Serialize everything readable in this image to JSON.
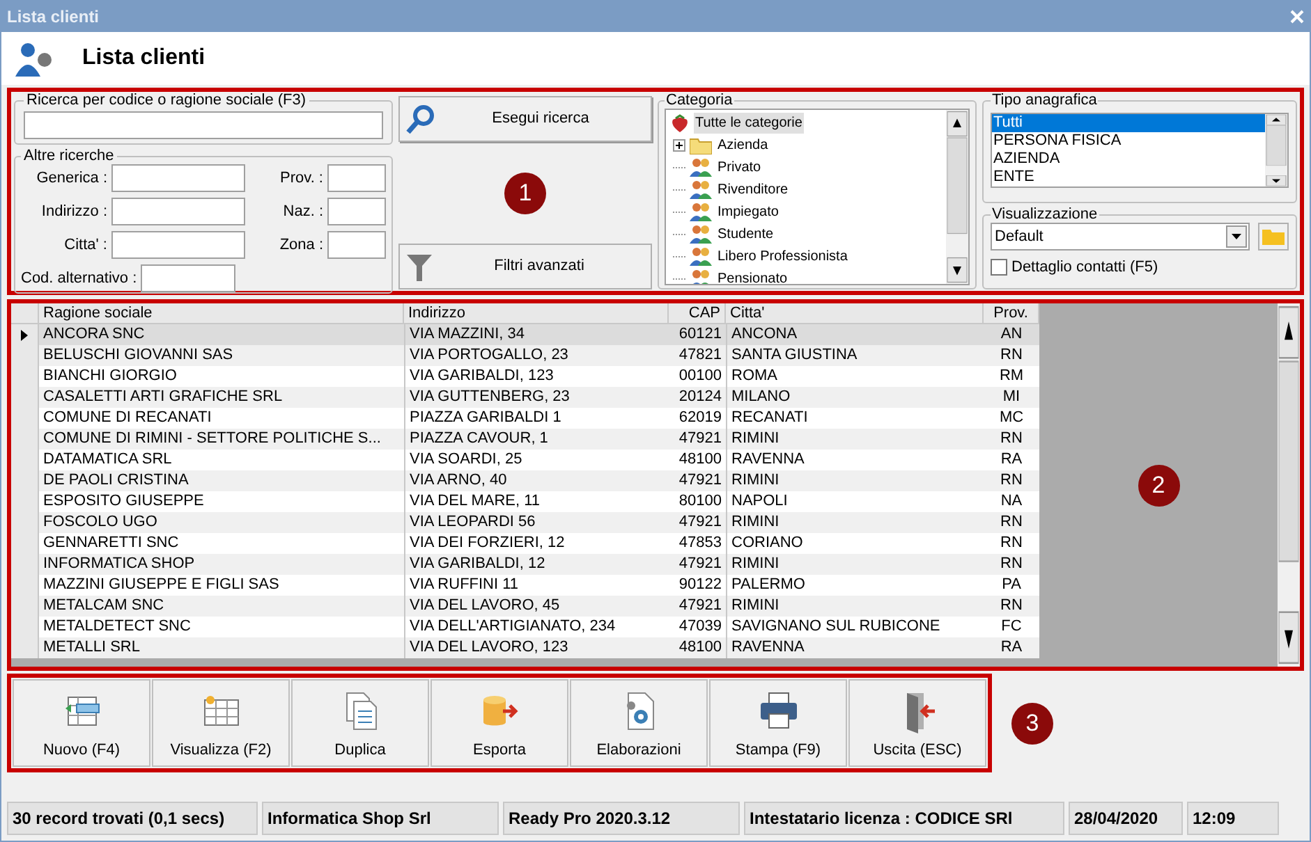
{
  "window": {
    "title": "Lista clienti"
  },
  "header": {
    "title": "Lista clienti"
  },
  "search": {
    "legend": "Ricerca per codice o ragione sociale (F3)",
    "button": "Esegui ricerca"
  },
  "other_search": {
    "legend": "Altre ricerche",
    "fields": [
      {
        "label": "Generica :"
      },
      {
        "label": "Prov. :"
      },
      {
        "label": "Indirizzo :"
      },
      {
        "label": "Naz. :"
      },
      {
        "label": "Citta' :"
      },
      {
        "label": "Zona :"
      },
      {
        "label": "Cod. alternativo :"
      }
    ]
  },
  "filter_button": "Filtri avanzati",
  "category": {
    "legend": "Categoria",
    "root": {
      "label": "Tutte le categorie",
      "selected": true,
      "children": [
        {
          "label": "Azienda",
          "kind": "folder",
          "expanded": false,
          "selected": false
        },
        {
          "label": "Privato",
          "kind": "group",
          "selected": false
        },
        {
          "label": "Rivenditore",
          "kind": "group",
          "selected": false
        },
        {
          "label": "Impiegato",
          "kind": "group",
          "selected": false
        },
        {
          "label": "Studente",
          "kind": "group",
          "selected": false
        },
        {
          "label": "Libero Professionista",
          "kind": "group",
          "selected": false
        },
        {
          "label": "Pensionato",
          "kind": "group",
          "selected": false
        }
      ]
    }
  },
  "record_type": {
    "legend": "Tipo anagrafica",
    "items": [
      {
        "label": "Tutti",
        "selected": true
      },
      {
        "label": "PERSONA FISICA",
        "selected": false
      },
      {
        "label": "AZIENDA",
        "selected": false
      },
      {
        "label": "ENTE",
        "selected": false
      }
    ]
  },
  "view": {
    "legend": "Visualizzazione",
    "value": "Default",
    "checkbox": {
      "label": "Dettaglio contatti (F5)",
      "checked": false
    }
  },
  "table": {
    "columns": [
      "Ragione sociale",
      "Indirizzo",
      "CAP",
      "Citta'",
      "Prov."
    ],
    "rows": [
      {
        "cells": [
          "ANCORA SNC",
          "VIA MAZZINI, 34",
          "60121",
          "ANCONA",
          "AN"
        ],
        "selected": true
      },
      {
        "cells": [
          "BELUSCHI GIOVANNI SAS",
          "VIA PORTOGALLO, 23",
          "47821",
          "SANTA GIUSTINA",
          "RN"
        ],
        "selected": false
      },
      {
        "cells": [
          "BIANCHI GIORGIO",
          "VIA GARIBALDI, 123",
          "00100",
          "ROMA",
          "RM"
        ],
        "selected": false
      },
      {
        "cells": [
          "CASALETTI ARTI GRAFICHE SRL",
          "VIA GUTTENBERG, 23",
          "20124",
          "MILANO",
          "MI"
        ],
        "selected": false
      },
      {
        "cells": [
          "COMUNE DI RECANATI",
          "PIAZZA GARIBALDI 1",
          "62019",
          "RECANATI",
          "MC"
        ],
        "selected": false
      },
      {
        "cells": [
          "COMUNE DI RIMINI - SETTORE POLITICHE S...",
          "PIAZZA CAVOUR, 1",
          "47921",
          "RIMINI",
          "RN"
        ],
        "selected": false
      },
      {
        "cells": [
          "DATAMATICA SRL",
          "VIA SOARDI, 25",
          "48100",
          "RAVENNA",
          "RA"
        ],
        "selected": false
      },
      {
        "cells": [
          "DE PAOLI CRISTINA",
          "VIA ARNO, 40",
          "47921",
          "RIMINI",
          "RN"
        ],
        "selected": false
      },
      {
        "cells": [
          "ESPOSITO GIUSEPPE",
          "VIA DEL MARE, 11",
          "80100",
          "NAPOLI",
          "NA"
        ],
        "selected": false
      },
      {
        "cells": [
          "FOSCOLO UGO",
          "VIA LEOPARDI 56",
          "47921",
          "RIMINI",
          "RN"
        ],
        "selected": false
      },
      {
        "cells": [
          "GENNARETTI SNC",
          "VIA DEI FORZIERI, 12",
          "47853",
          "CORIANO",
          "RN"
        ],
        "selected": false
      },
      {
        "cells": [
          "INFORMATICA SHOP",
          "VIA GARIBALDI, 12",
          "47921",
          "RIMINI",
          "RN"
        ],
        "selected": false
      },
      {
        "cells": [
          "MAZZINI GIUSEPPE E FIGLI SAS",
          "VIA RUFFINI 11",
          "90122",
          "PALERMO",
          "PA"
        ],
        "selected": false
      },
      {
        "cells": [
          "METALCAM SNC",
          "VIA DEL LAVORO, 45",
          "47921",
          "RIMINI",
          "RN"
        ],
        "selected": false
      },
      {
        "cells": [
          "METALDETECT SNC",
          "VIA DELL'ARTIGIANATO, 234",
          "47039",
          "SAVIGNANO SUL RUBICONE",
          "FC"
        ],
        "selected": false
      },
      {
        "cells": [
          "METALLI SRL",
          "VIA DEL LAVORO, 123",
          "48100",
          "RAVENNA",
          "RA"
        ],
        "selected": false
      }
    ]
  },
  "toolbar": [
    {
      "label": "Nuovo (F4)",
      "kind": "new"
    },
    {
      "label": "Visualizza (F2)",
      "kind": "view"
    },
    {
      "label": "Duplica",
      "kind": "copy"
    },
    {
      "label": "Esporta",
      "kind": "export"
    },
    {
      "label": "Elaborazioni",
      "kind": "process"
    },
    {
      "label": "Stampa (F9)",
      "kind": "print"
    },
    {
      "label": "Uscita (ESC)",
      "kind": "exit"
    }
  ],
  "markers": [
    "1",
    "2",
    "3"
  ],
  "status_bar": [
    "30 record trovati (0,1 secs)",
    "Informatica Shop Srl",
    "Ready Pro 2020.3.12",
    "Intestatario licenza : CODICE SRl",
    "28/04/2020",
    "12:09"
  ]
}
